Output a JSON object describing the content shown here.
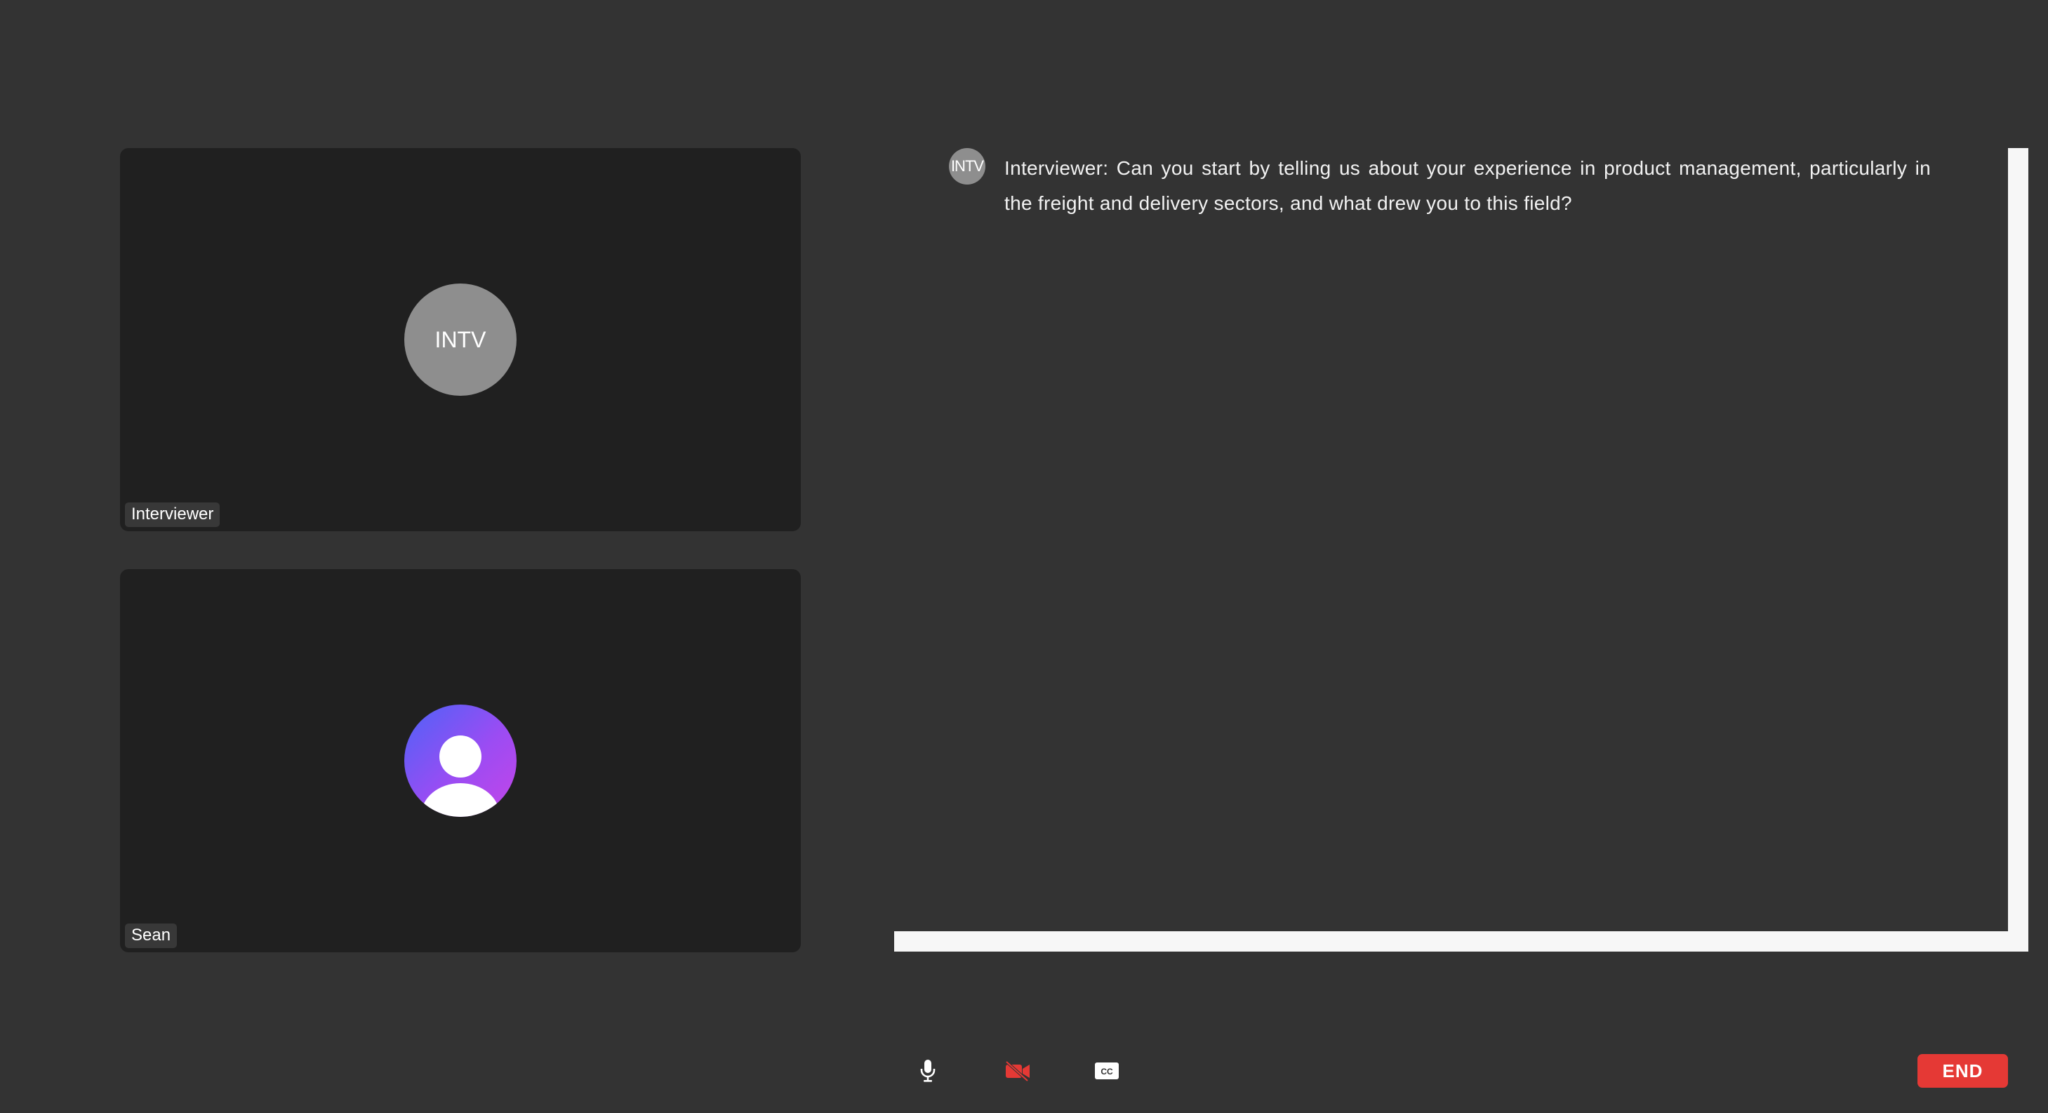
{
  "participants": [
    {
      "name": "Interviewer",
      "initials": "INTV"
    },
    {
      "name": "Sean"
    }
  ],
  "transcript": {
    "messages": [
      {
        "avatar_initials": "INTV",
        "text": "Interviewer: Can you start by telling us about your experience in product management, particularly in the freight and delivery sectors, and what drew you to this field?"
      }
    ]
  },
  "controls": {
    "microphone": {
      "icon": "microphone-icon",
      "state": "on"
    },
    "camera": {
      "icon": "camera-off-icon",
      "state": "off",
      "color": "#e53935"
    },
    "captions": {
      "icon": "closed-captions-icon"
    },
    "end_label": "END",
    "end_color": "#e53935"
  }
}
